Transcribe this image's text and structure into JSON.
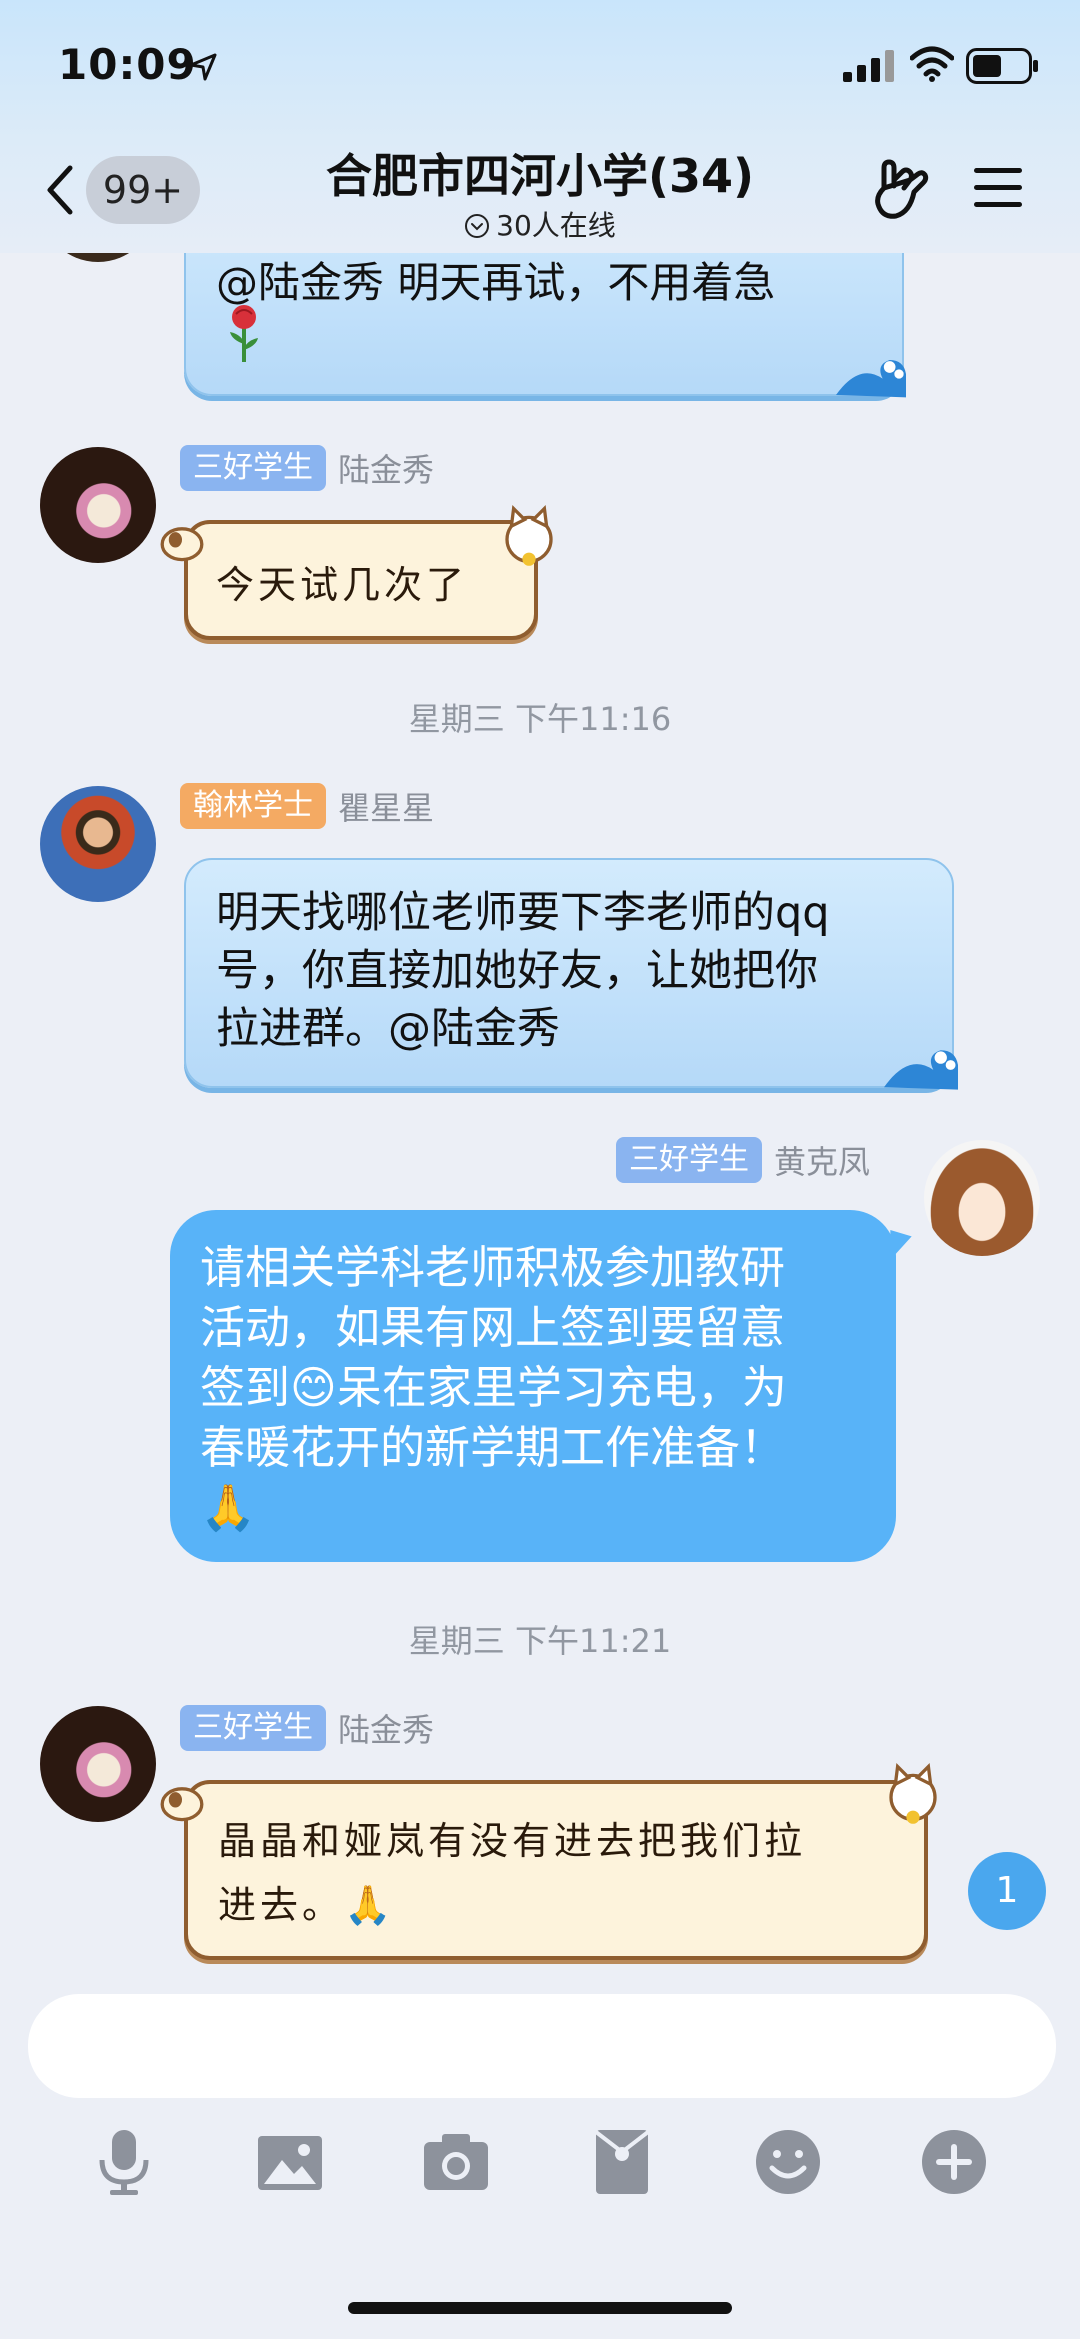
{
  "status": {
    "time": "10:09"
  },
  "nav": {
    "back_count": "99+",
    "title": "合肥市四河小学(34)",
    "online": "30人在线"
  },
  "messages": [
    {
      "text_line1": "@陆金秀 明天再试，不用着急"
    },
    {
      "tag": "三好学生",
      "name": "陆金秀",
      "text": "今天试几次了"
    },
    {
      "timestamp": "星期三 下午11:16"
    },
    {
      "tag": "翰林学士",
      "name": "瞿星星",
      "lines": [
        "明天找哪位老师要下李老师的qq",
        "号，你直接加她好友，让她把你",
        "拉进群。@陆金秀"
      ]
    },
    {
      "tag": "三好学生",
      "name": "黄克凤",
      "lines": [
        "请相关学科老师积极参加教研",
        "活动，如果有网上签到要留意",
        "签到😊呆在家里学习充电，为",
        "春暖花开的新学期工作准备！",
        "🙏"
      ]
    },
    {
      "timestamp": "星期三 下午11:21"
    },
    {
      "tag": "三好学生",
      "name": "陆金秀",
      "lines": [
        "晶晶和娅岚有没有进去把我们拉",
        "进去。🙏"
      ]
    }
  ],
  "unread_count": "1",
  "colors": {
    "accent": "#58b3f8",
    "tag_blue": "#8ab4f0",
    "tag_orange": "#f4aa63"
  },
  "icons": [
    "location-arrow-icon",
    "signal-icon",
    "wifi-icon",
    "battery-icon",
    "back-icon",
    "hand-gesture-icon",
    "menu-icon",
    "microphone-icon",
    "image-icon",
    "camera-icon",
    "red-packet-icon",
    "emoji-icon",
    "plus-icon"
  ]
}
